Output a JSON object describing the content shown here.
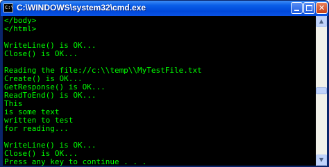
{
  "window": {
    "title": "C:\\WINDOWS\\system32\\cmd.exe",
    "icon_text": "C:\\",
    "minimize_label": "",
    "maximize_label": "",
    "close_label": "✕"
  },
  "console": {
    "text_color": "#00ff00",
    "background": "#000000",
    "lines": [
      "</body>",
      "</html>",
      "",
      "WriteLine() is OK...",
      "Close() is OK...",
      "",
      "Reading the file://c:\\\\temp\\\\MyTestFile.txt",
      "Create() is OK...",
      "GetResponse() is OK...",
      "ReadToEnd() is OK...",
      "This",
      "is some text",
      "written to test",
      "for reading...",
      "",
      "WriteLine() is OK...",
      "Close() is OK...",
      "Press any key to continue . . ."
    ]
  },
  "scrollbar": {
    "up_arrow": "▲",
    "down_arrow": "▼",
    "position_fraction": 0.5
  }
}
